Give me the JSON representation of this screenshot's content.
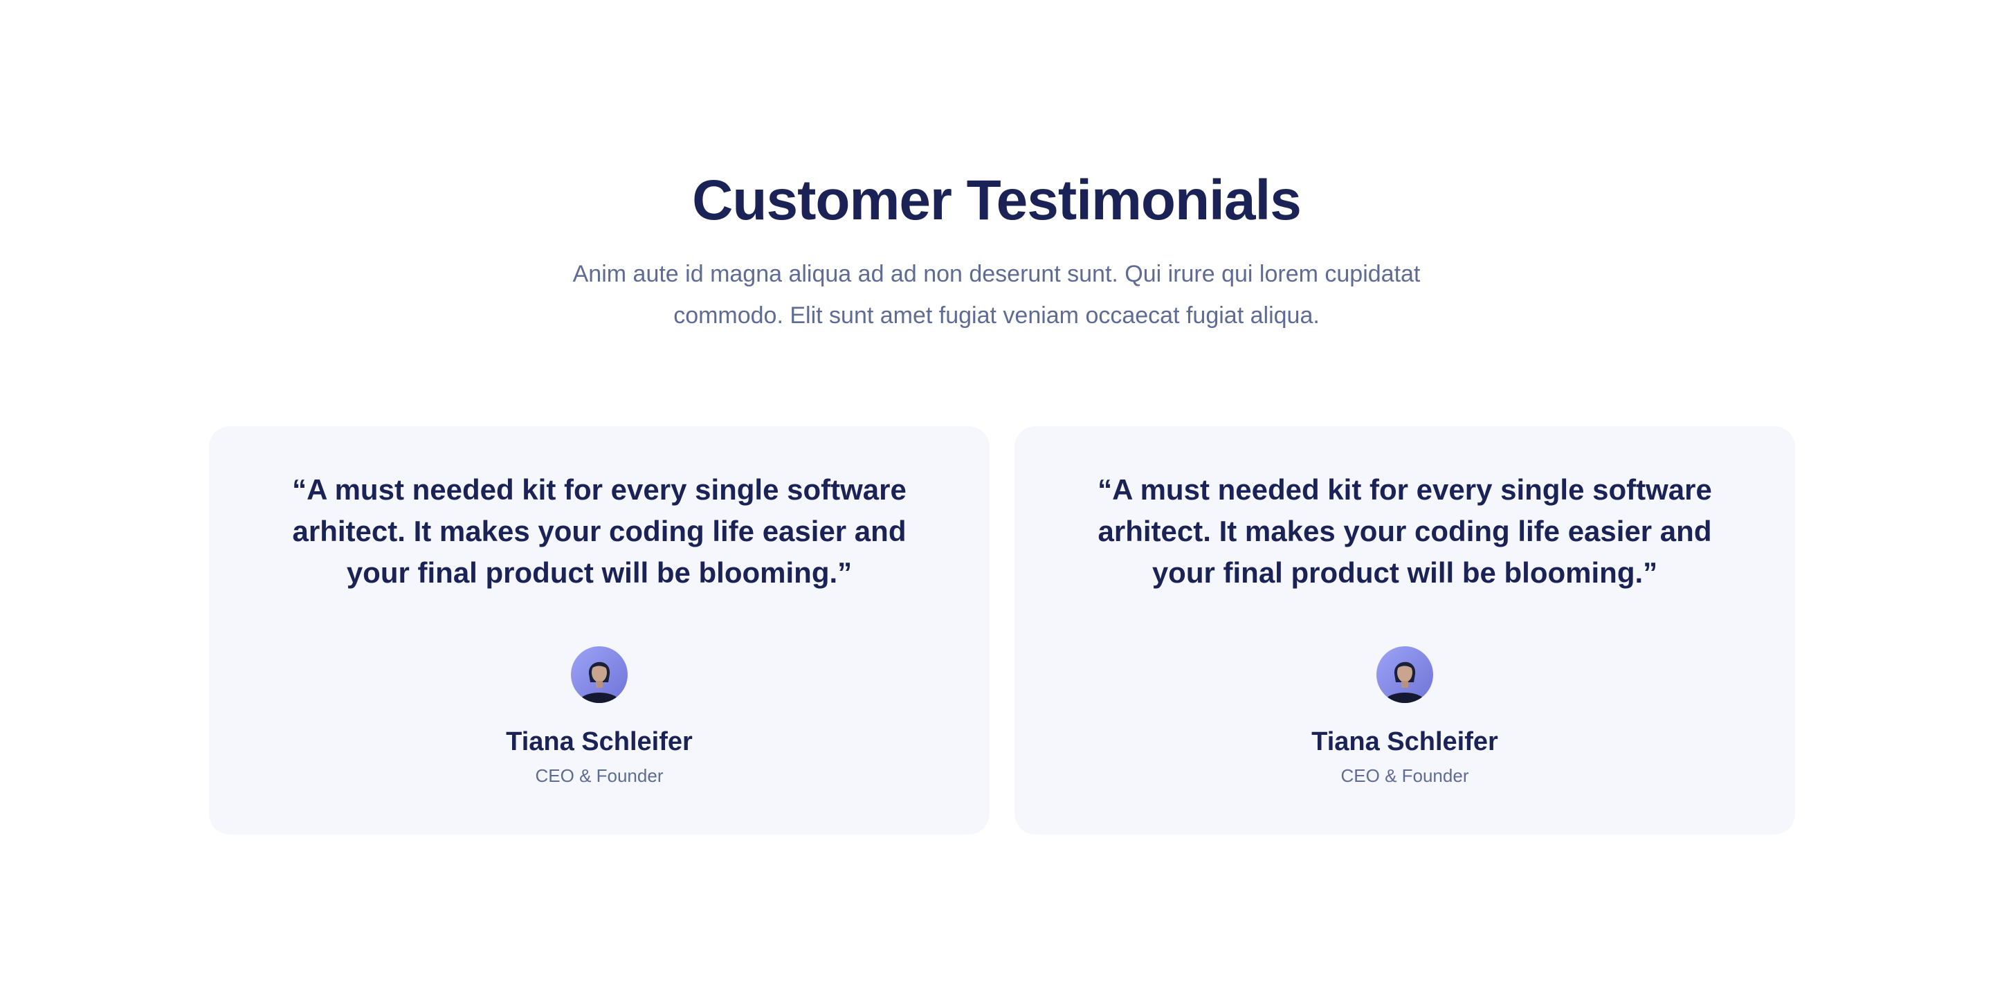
{
  "section": {
    "title": "Customer Testimonials",
    "subtitle": "Anim aute id magna aliqua ad ad non deserunt sunt. Qui irure qui lorem cupidatat commodo. Elit sunt amet fugiat veniam occaecat fugiat aliqua."
  },
  "testimonials": [
    {
      "quote": "“A must needed kit for every single software arhitect. It makes your coding life easier and your final product will be blooming.”",
      "name": "Tiana Schleifer",
      "role": "CEO & Founder",
      "avatar_icon": "person-avatar"
    },
    {
      "quote": "“A must needed kit for every single software arhitect. It makes your coding life easier and your final product will be blooming.”",
      "name": "Tiana Schleifer",
      "role": "CEO & Founder",
      "avatar_icon": "person-avatar"
    }
  ],
  "colors": {
    "heading": "#1b2356",
    "muted": "#5f6b94",
    "card_bg": "#f5f7fc",
    "avatar_bg": "#8b8ff0"
  }
}
